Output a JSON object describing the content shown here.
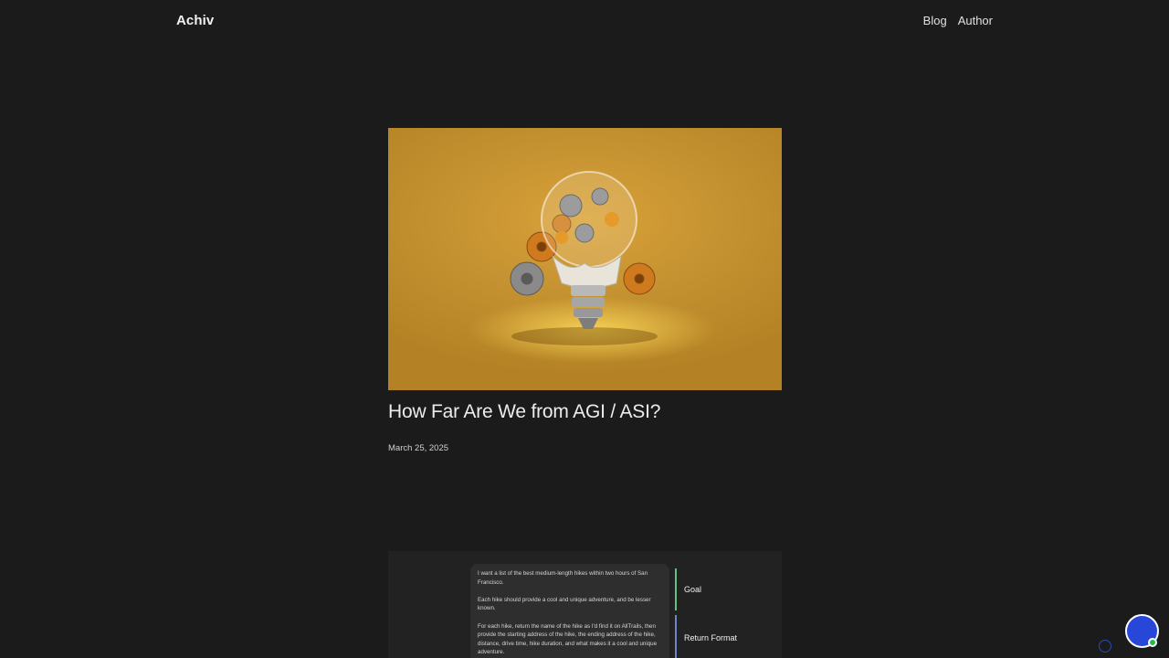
{
  "header": {
    "brand": "Achiv",
    "nav": [
      {
        "label": "Blog"
      },
      {
        "label": "Author"
      }
    ]
  },
  "post": {
    "title": "How Far Are We from AGI / ASI?",
    "date": "March 25, 2025",
    "hero_image": "lightbulb-with-gears-image"
  },
  "preview": {
    "prompt_paragraphs": [
      "I want a list of the best medium-length hikes within two hours of San Francisco.",
      "Each hike should provide a cool and unique adventure, and be lesser known.",
      "For each hike, return the name of the hike as I'd find it on AllTrails, then provide the starting address of the hike, the ending address of the hike, distance, drive time, hike duration, and what makes it a cool and unique adventure."
    ],
    "tags": {
      "goal": "Goal",
      "return_format": "Return Format"
    },
    "tag_colors": {
      "goal": "#66c281",
      "return_format": "#6f84c9"
    }
  },
  "widget": {
    "chat_icon": "chat-bubble-icon",
    "color": "#2747d8",
    "status_color": "#1fbf4a"
  },
  "theme": {
    "background": "#1b1b1b",
    "text": "#e6e6e6"
  }
}
